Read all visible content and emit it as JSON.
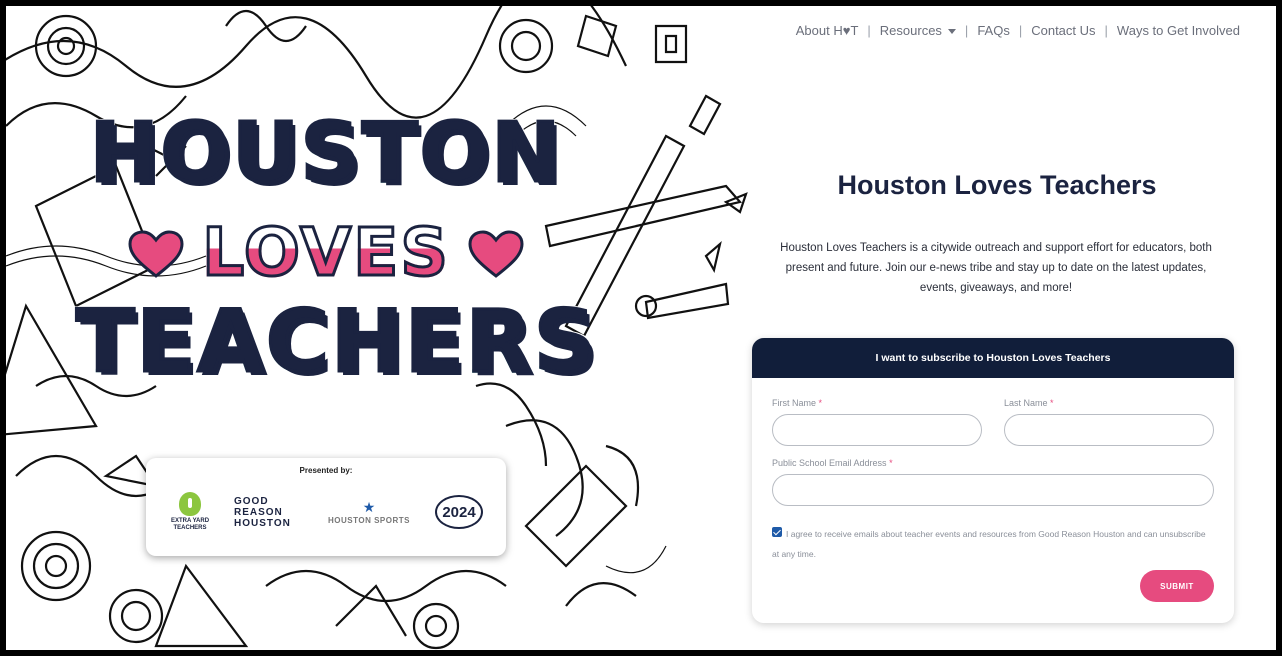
{
  "nav": {
    "items": [
      {
        "label": "About H♥T"
      },
      {
        "label": "Resources"
      },
      {
        "label": "FAQs"
      },
      {
        "label": "Contact Us"
      },
      {
        "label": "Ways to Get Involved"
      }
    ],
    "separator": "|"
  },
  "logo": {
    "line1": "HOUSTON",
    "line2": "LOVES",
    "line3": "TEACHERS",
    "colors": {
      "navy": "#1b2340",
      "teal": "#5fc2b3",
      "pink": "#e64b7f"
    }
  },
  "presented_by": {
    "label": "Presented by:",
    "sponsors": [
      {
        "name": "EXTRA YARD TEACHERS",
        "icon": "apple-icon"
      },
      {
        "name": "GOOD REASON HOUSTON"
      },
      {
        "name": "HOUSTON SPORTS"
      },
      {
        "name": "2024"
      }
    ]
  },
  "main": {
    "title": "Houston Loves Teachers",
    "description": "Houston Loves Teachers is a citywide outreach and support effort for educators, both present and future. Join our e-news tribe and stay up to date on the latest updates, events, giveaways, and more!"
  },
  "form": {
    "header": "I want to subscribe to Houston Loves Teachers",
    "first_name_label": "First Name",
    "last_name_label": "Last Name",
    "email_label": "Public School Email Address",
    "required_mark": "*",
    "consent_text": "I agree to receive emails about teacher events and resources from Good Reason Houston and can unsubscribe at any time.",
    "consent_checked": true,
    "submit_label": "SUBMIT",
    "accent": "#e64b7f",
    "header_bg": "#111e3a"
  }
}
